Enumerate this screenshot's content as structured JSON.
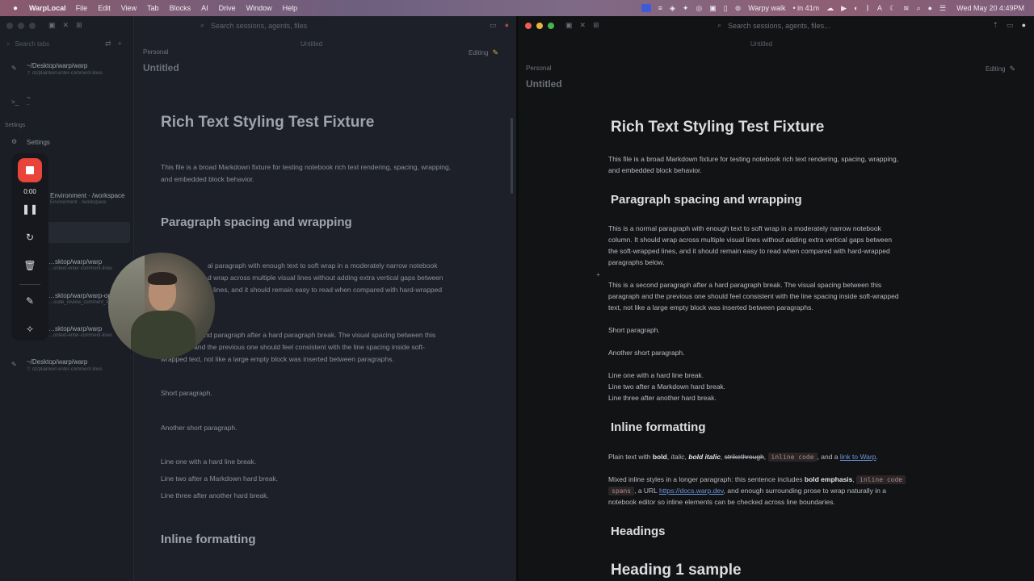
{
  "menubar": {
    "app_name": "WarpLocal",
    "items": [
      "File",
      "Edit",
      "View",
      "Tab",
      "Blocks",
      "AI",
      "Drive",
      "Window",
      "Help"
    ],
    "tray_event": "Warpy walk",
    "tray_event_time": "• in 41m",
    "clock": "Wed May 20  4:49PM"
  },
  "left_window": {
    "search_placeholder": "Search sessions, agents, files",
    "tab_title": "Untitled",
    "sidebar": {
      "search_placeholder": "Search tabs",
      "items": [
        {
          "path": "~/Desktop/warp/warp",
          "sub": "⇪ oz/plaintext-enter-comment-lines"
        },
        {
          "path": "~",
          "sub": "–"
        },
        {
          "section": "Settings",
          "label": "Settings"
        },
        {
          "path": "Environment · /workspace",
          "sub": "Environment · /workspace"
        },
        {
          "path": "…sktop/warp/warp",
          "sub": "…ontext-enter-comment-lines"
        },
        {
          "path": "…sktop/warp/warp-open",
          "sub": "…oude_review_comment_lines"
        },
        {
          "path": "…sktop/warp/warp",
          "sub": "…ontext-enter-comment-lines"
        },
        {
          "path": "~/Desktop/warp/warp",
          "sub": "⇪ oz/plaintext-enter-comment-lines"
        }
      ]
    },
    "recorder": {
      "time": "0:00"
    },
    "editor": {
      "breadcrumb": "Personal",
      "title": "Untitled",
      "mode": "Editing",
      "h1": "Rich Text Styling Test Fixture",
      "intro_l1": "This file is a broad Markdown fixture for testing notebook rich text rendering, spacing, wrapping,",
      "intro_l2": "and embedded block behavior.",
      "h2_spacing": "Paragraph spacing and wrapping",
      "p1_l1": "al paragraph with enough text to soft wrap in a moderately narrow notebook",
      "p1_l2": "d wrap across multiple visual lines without adding extra vertical gaps between",
      "p1_l3": "d lines, and it should remain easy to read when compared with hard-wrapped",
      "p1_l4": "w.",
      "p2_l1": "second paragraph after a hard paragraph break. The visual spacing between this",
      "p2_l2": "paragraph and the previous one should feel consistent with the line spacing inside soft-",
      "p2_l3": "wrapped text, not like a large empty block was inserted between paragraphs.",
      "short1": "Short paragraph.",
      "short2": "Another short paragraph.",
      "line1": "Line one with a hard line break.",
      "line2": "Line two after a Markdown hard break.",
      "line3": "Line three after another hard break.",
      "h2_inline": "Inline formatting"
    }
  },
  "right_window": {
    "search_placeholder": "Search sessions, agents, files...",
    "tab_title": "Untitled",
    "editor": {
      "breadcrumb": "Personal",
      "title": "Untitled",
      "mode": "Editing",
      "h1": "Rich Text Styling Test Fixture",
      "intro_l1": "This file is a broad Markdown fixture for testing notebook rich text rendering, spacing, wrapping,",
      "intro_l2": "and embedded block behavior.",
      "h2_spacing": "Paragraph spacing and wrapping",
      "p1_l1": "This is a normal paragraph with enough text to soft wrap in a moderately narrow notebook",
      "p1_l2": "column. It should wrap across multiple visual lines without adding extra vertical gaps between",
      "p1_l3": "the soft-wrapped lines, and it should remain easy to read when compared with hard-wrapped",
      "p1_l4": "paragraphs below.",
      "p2_l1": "This is a second paragraph after a hard paragraph break. The visual spacing between this",
      "p2_l2": "paragraph and the previous one should feel consistent with the line spacing inside soft-wrapped",
      "p2_l3": "text, not like a large empty block was inserted between paragraphs.",
      "short1": "Short paragraph.",
      "short2": "Another short paragraph.",
      "line1": "Line one with a hard line break.",
      "line2": "Line two after a Markdown hard break.",
      "line3": "Line three after another hard break.",
      "h2_inline": "Inline formatting",
      "inline": {
        "prefix": "Plain text with ",
        "bold": "bold",
        "italic": "italic",
        "bold_italic": "bold italic",
        "strike": "strikethrough",
        "code": "inline code",
        "and_a": ", and a ",
        "link": "link to Warp",
        "end": "."
      },
      "mixed": {
        "prefix": "Mixed inline styles in a longer paragraph: this sentence includes ",
        "bold": "bold emphasis",
        "code1": "inline code",
        "code2": "spans",
        "url_pre": ", a URL ",
        "url": "https://docs.warp.dev",
        "rest1": ", and enough surrounding prose to wrap naturally in a",
        "rest2": "notebook editor so inline elements can be checked across line boundaries."
      },
      "h2_headings": "Headings",
      "h1_sample": "Heading 1 sample"
    }
  },
  "colors": {
    "accent_red": "#e8443a",
    "link": "#6b95d8",
    "pencil": "#d6b04a"
  }
}
